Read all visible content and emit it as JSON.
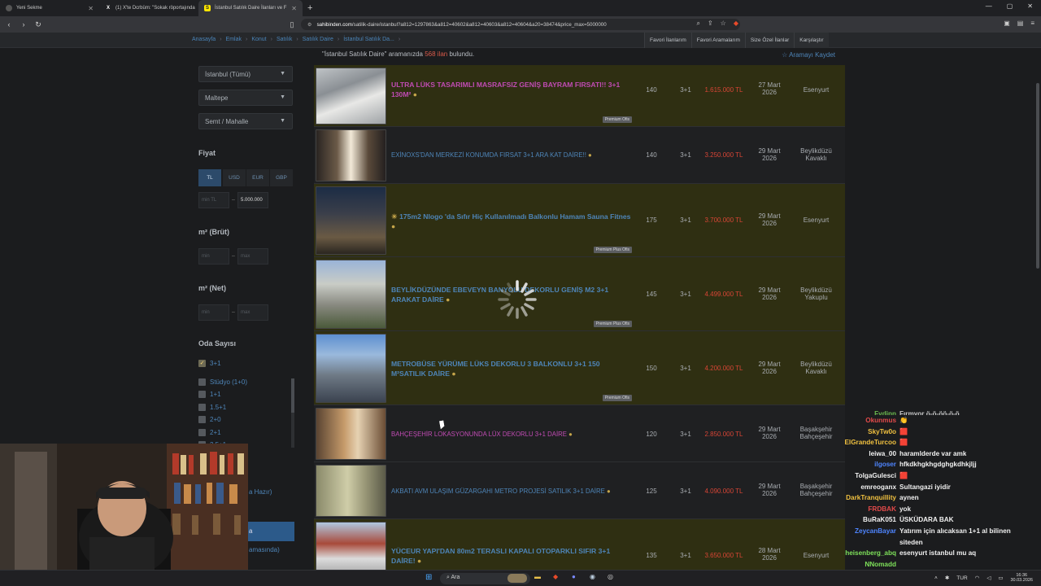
{
  "browser": {
    "tabs": [
      {
        "title": "Yeni Sekme",
        "active": false
      },
      {
        "title": "(1) X'te Dcrbüm: \"Sokak röportajında",
        "active": false
      },
      {
        "title": "İstanbul Satılık Daire İlanları ve F",
        "active": true
      }
    ],
    "url_prefix": "sahibinden.com",
    "url": "/satilik-daire/istanbul?a812=1297863&a812=40602&a812=40603&a812=40604&a20=38474&price_max=5000000"
  },
  "site": {
    "breadcrumb": [
      "Anasayfa",
      "Emlak",
      "Konut",
      "Satılık",
      "Satılık Daire",
      "İstanbul Satılık Da..."
    ],
    "top_links": [
      "Favori İlanlarım",
      "Favori Aramalarım",
      "Size Özel İlanlar",
      "Karşılaştır"
    ]
  },
  "sidebar": {
    "city": "İstanbul (Tümü)",
    "district": "Maltepe",
    "neighborhood": "Semt / Mahalle",
    "price_label": "Fiyat",
    "currencies": [
      "TL",
      "USD",
      "EUR",
      "GBP"
    ],
    "price_min_ph": "min TL",
    "price_max": "5.000.000",
    "gross_label": "m² (Brüt)",
    "net_label": "m² (Net)",
    "min_ph": "min",
    "max_ph": "max",
    "rooms_label": "Oda Sayısı",
    "rooms": [
      {
        "label": "3+1",
        "checked": true
      },
      {
        "label": "Stüdyo (1+0)",
        "checked": false
      },
      {
        "label": "1+1",
        "checked": false
      },
      {
        "label": "1.5+1",
        "checked": false
      },
      {
        "label": "2+0",
        "checked": false
      },
      {
        "label": "2+1",
        "checked": false
      },
      {
        "label": "2.5+1",
        "checked": false
      }
    ],
    "partial_1": "a Hazır)",
    "partial_2": "a",
    "partial_3": "amasında)"
  },
  "results": {
    "query": "\"İstanbul Satılık Daire\"",
    "mid": " aramanızda ",
    "count": "568 ilan",
    "suffix": " bulundu.",
    "save_search": "Aramayı Kaydet"
  },
  "listings": [
    {
      "title": "ULTRA LÜKS TASARIMLI MASRAFSIZ GENİŞ BAYRAM FIRSATI!! 3+1 130M²",
      "m2": "140",
      "rooms": "3+1",
      "price": "1.615.000 TL",
      "date": "27 Mart",
      "year": "2026",
      "loc1": "Esenyurt",
      "loc2": "",
      "badge": "Premium Ofis",
      "pink": true,
      "highlight": true
    },
    {
      "title": "EXİNOXS'DAN MERKEZİ KONUMDA FIRSAT 3+1 ARA KAT DAİRE!!",
      "m2": "140",
      "rooms": "3+1",
      "price": "3.250.000 TL",
      "date": "29 Mart",
      "year": "2026",
      "loc1": "Beylikdüzü",
      "loc2": "Kavaklı",
      "badge": "",
      "pink": false,
      "highlight": false
    },
    {
      "title": "175m2 Nlogo 'da Sıfır Hiç Kullanılmadı Balkonlu Hamam Sauna Fitnes",
      "m2": "175",
      "rooms": "3+1",
      "price": "3.700.000 TL",
      "date": "29 Mart",
      "year": "2026",
      "loc1": "Esenyurt",
      "loc2": "",
      "badge": "Premium Plus Ofis",
      "pink": false,
      "highlight": true
    },
    {
      "title": "BEYLİKDÜZÜNDE EBEVEYN BANYOLU DEKORLU GENİŞ M2 3+1 ARAKAT DAİRE",
      "m2": "145",
      "rooms": "3+1",
      "price": "4.499.000 TL",
      "date": "29 Mart",
      "year": "2026",
      "loc1": "Beylikdüzü",
      "loc2": "Yakuplu",
      "badge": "Premium Plus Ofis",
      "pink": false,
      "highlight": true
    },
    {
      "title": "METROBÜSE YÜRÜME LÜKS DEKORLU 3 BALKONLU 3+1 150 M²SATILIK DAİRE",
      "m2": "150",
      "rooms": "3+1",
      "price": "4.200.000 TL",
      "date": "29 Mart",
      "year": "2026",
      "loc1": "Beylikdüzü",
      "loc2": "Kavaklı",
      "badge": "Premium Ofis",
      "pink": false,
      "highlight": true
    },
    {
      "title": "BAHÇEŞEHİR LOKASYONUNDA LÜX DEKORLU 3+1 DAİRE",
      "m2": "120",
      "rooms": "3+1",
      "price": "2.850.000 TL",
      "date": "29 Mart",
      "year": "2026",
      "loc1": "Başakşehir",
      "loc2": "Bahçeşehir",
      "badge": "",
      "pink": true,
      "highlight": false
    },
    {
      "title": "AKBATI AVM ULAŞIM GÜZARGAHI METRO PROJESİ SATILIK 3+1 DAİRE",
      "m2": "125",
      "rooms": "3+1",
      "price": "4.090.000 TL",
      "date": "29 Mart",
      "year": "2026",
      "loc1": "Başakşehir",
      "loc2": "Bahçeşehir",
      "badge": "",
      "pink": false,
      "highlight": false
    },
    {
      "title": "YÜCEUR YAPI'DAN 80m2 TERASLI KAPALI OTOPARKLI SIFIR 3+1 DAİRE!",
      "m2": "135",
      "rooms": "3+1",
      "price": "3.650.000 TL",
      "date": "28 Mart",
      "year": "2026",
      "loc1": "Esenyurt",
      "loc2": "",
      "badge": "",
      "pink": false,
      "highlight": true
    }
  ],
  "chat": [
    {
      "user": "Fydipn",
      "msg": "Fırmyor ö-ö-öö-ö-ö",
      "color": "#7ee05a"
    },
    {
      "user": "Okunmus",
      "msg": "👏",
      "color": "#e24a4a"
    },
    {
      "user": "SkyTw0o",
      "msg": "🟥",
      "color": "#f0c040"
    },
    {
      "user": "ElGrandeTurcoo",
      "msg": "🟥",
      "color": "#f0c040"
    },
    {
      "user": "leiwa_00",
      "msg": "haramlderde var amk",
      "color": "#f0f0f0"
    },
    {
      "user": "ilgoser",
      "msg": "hfkdkhgkhgdghgkdhkjljj",
      "color": "#4e85ff"
    },
    {
      "user": "TolgaGulesci",
      "msg": "🟥",
      "color": "#f0f0f0"
    },
    {
      "user": "emreoganx",
      "msg": "Sultangazi iyidir",
      "color": "#f0f0f0"
    },
    {
      "user": "DarkTranquillity",
      "msg": "aynen",
      "color": "#f0c040"
    },
    {
      "user": "FRDBAK",
      "msg": "yok",
      "color": "#e24a4a"
    },
    {
      "user": "BuRaK051",
      "msg": "ÜSKÜDARA BAK",
      "color": "#f0f0f0"
    },
    {
      "user": "ZeycanBayar",
      "msg": "Yatırım için alıcaksan 1+1 al bilinen",
      "color": "#4e85ff"
    },
    {
      "user": "",
      "msg": "siteden",
      "color": "#f0f0f0"
    },
    {
      "user": "heisenberg_abq",
      "msg": "esenyurt istanbul mu aq",
      "color": "#7ee05a"
    },
    {
      "user": "NNomadd",
      "msg": "",
      "color": "#7ee05a"
    }
  ],
  "taskbar": {
    "search": "Ara",
    "lang": "TUR",
    "time": "16:36",
    "date": "30.03.2026"
  },
  "colors": {
    "link": "#4e85b8",
    "price": "#d74535",
    "highlight": "#2f2f12",
    "pink": "#c04bb3"
  }
}
